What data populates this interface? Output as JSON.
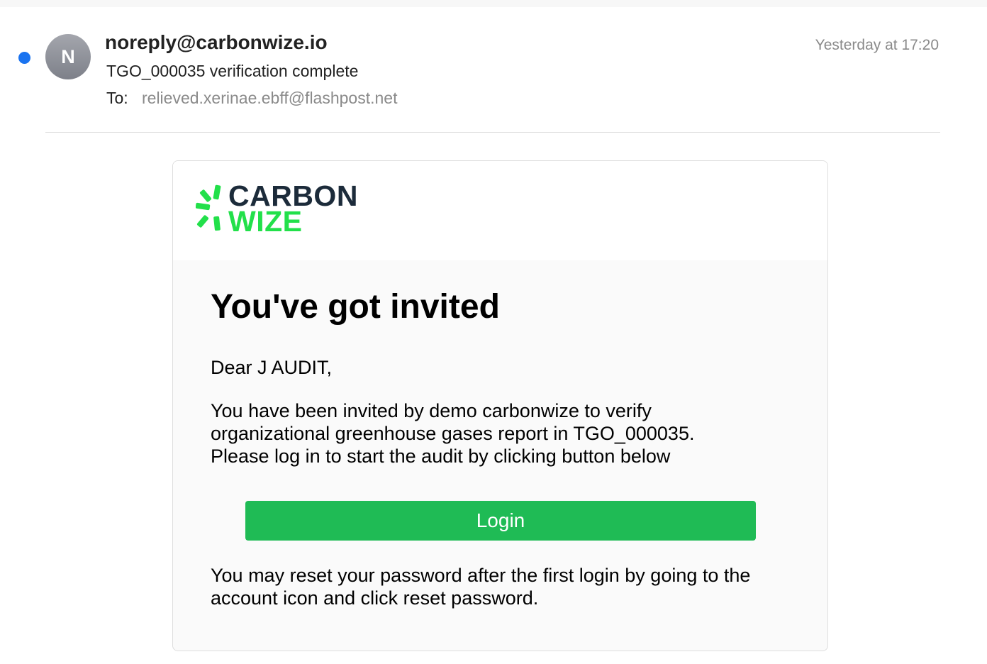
{
  "email": {
    "sender": "noreply@carbonwize.io",
    "avatar_initial": "N",
    "subject": "TGO_000035 verification complete",
    "to_label": "To:",
    "to_address": "relieved.xerinae.ebff@flashpost.net",
    "timestamp": "Yesterday at 17:20",
    "unread": true
  },
  "message": {
    "logo": {
      "line1": "CARBON",
      "line2": "WIZE",
      "icon": "sunburst-logo-icon"
    },
    "headline": "You've got invited",
    "greeting": "Dear J AUDIT,",
    "body_lines": [
      "You have been invited by demo carbonwize to verify",
      "organizational greenhouse gases report in TGO_000035.",
      "Please log in to start the audit by clicking button below"
    ],
    "login_label": "Login",
    "footer_lines": [
      "You may reset your password after the first login by going to the",
      "account icon and click reset password."
    ]
  },
  "colors": {
    "unread_dot": "#1a73f0",
    "brand_dark": "#1c2b3a",
    "brand_green": "#22e04a",
    "button_green": "#1fbb55"
  }
}
